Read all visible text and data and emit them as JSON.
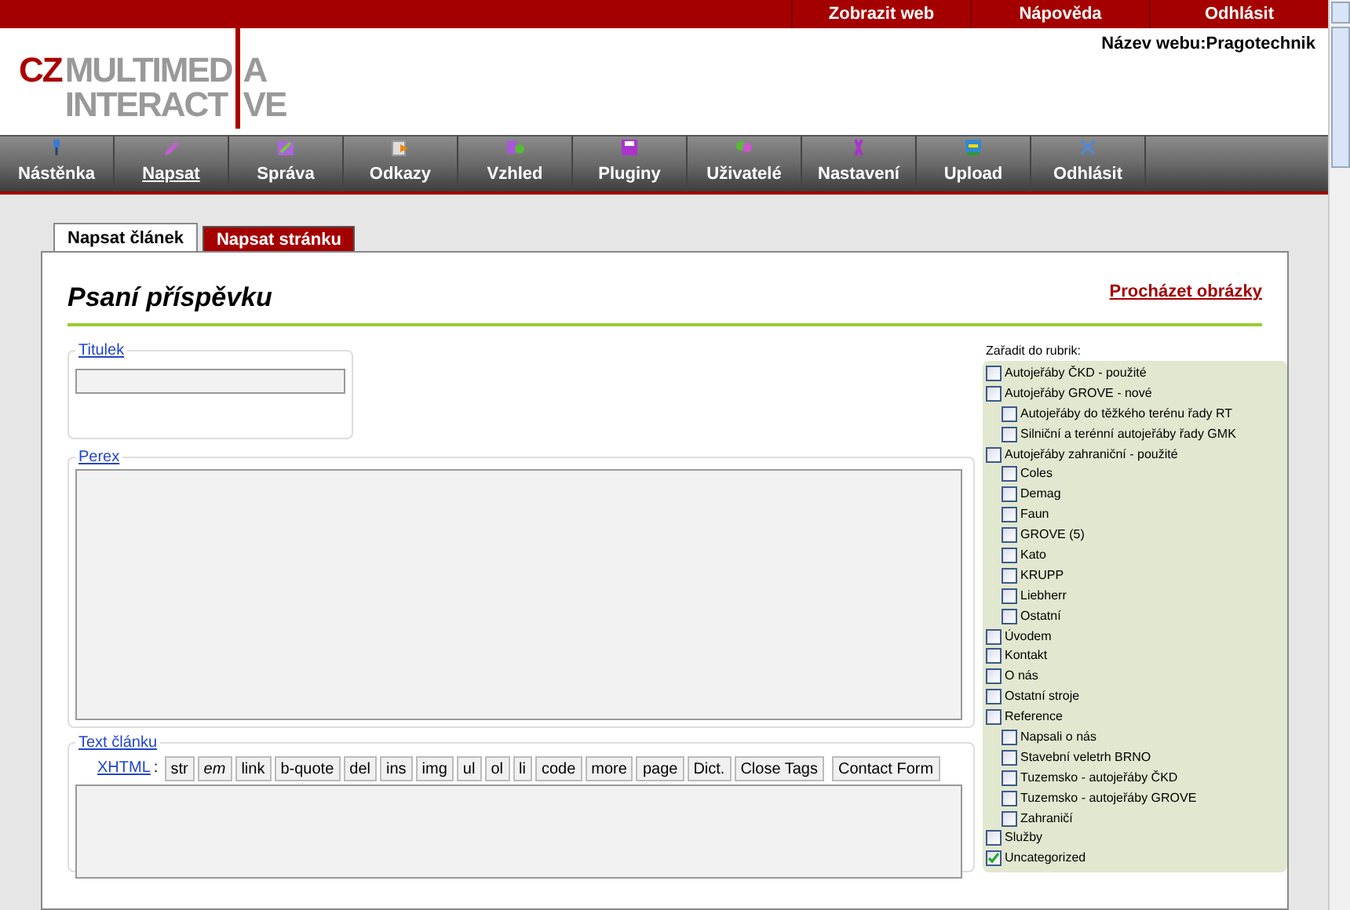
{
  "top_links": [
    "Zobrazit web",
    "Nápověda",
    "Odhlásit"
  ],
  "site_name": "Název webu:Pragotechnik",
  "logo": {
    "cz": "CZ",
    "line1_a": "MULTIMED",
    "line1_b": "A",
    "line2_a": "INTERACT",
    "line2_b": "VE"
  },
  "nav": [
    {
      "label": "Nástěnka",
      "selected": false
    },
    {
      "label": "Napsat",
      "selected": true
    },
    {
      "label": "Správa",
      "selected": false
    },
    {
      "label": "Odkazy",
      "selected": false
    },
    {
      "label": "Vzhled",
      "selected": false
    },
    {
      "label": "Pluginy",
      "selected": false
    },
    {
      "label": "Uživatelé",
      "selected": false
    },
    {
      "label": "Nastavení",
      "selected": false
    },
    {
      "label": "Upload",
      "selected": false
    },
    {
      "label": "Odhlásit",
      "selected": false
    }
  ],
  "tabs": [
    {
      "label": "Napsat článek",
      "selected": true
    },
    {
      "label": "Napsat stránku",
      "selected": false
    }
  ],
  "heading": "Psaní příspěvku",
  "browse_images": "Procházet obrázky",
  "title_field": {
    "legend": "Titulek"
  },
  "perex_field": {
    "legend": "Perex"
  },
  "text_field": {
    "legend": "Text článku",
    "xhtml_label": "XHTML",
    "xhtml_colon": ":",
    "buttons": [
      "str",
      "em",
      "link",
      "b-quote",
      "del",
      "ins",
      "img",
      "ul",
      "ol",
      "li",
      "code",
      "more",
      "page",
      "Dict.",
      "Close Tags",
      "Contact Form"
    ]
  },
  "categories": {
    "label": "Zařadit do rubrik:",
    "items": [
      {
        "label": "Autojeřáby ČKD - použité",
        "checked": false
      },
      {
        "label": "Autojeřáby GROVE - nové",
        "checked": false,
        "children": [
          {
            "label": "Autojeřáby do těžkého terénu řady RT",
            "checked": false
          },
          {
            "label": "Silniční a terénní autojeřáby řady GMK",
            "checked": false
          }
        ]
      },
      {
        "label": "Autojeřáby zahraniční - použité",
        "checked": false,
        "children": [
          {
            "label": "Coles",
            "checked": false
          },
          {
            "label": "Demag",
            "checked": false
          },
          {
            "label": "Faun",
            "checked": false
          },
          {
            "label": "GROVE (5)",
            "checked": false
          },
          {
            "label": "Kato",
            "checked": false
          },
          {
            "label": "KRUPP",
            "checked": false
          },
          {
            "label": "Liebherr",
            "checked": false
          },
          {
            "label": "Ostatní",
            "checked": false
          }
        ]
      },
      {
        "label": "Úvodem",
        "checked": false
      },
      {
        "label": "Kontakt",
        "checked": false
      },
      {
        "label": "O nás",
        "checked": false
      },
      {
        "label": "Ostatní stroje",
        "checked": false
      },
      {
        "label": "Reference",
        "checked": false,
        "children": [
          {
            "label": "Napsali o nás",
            "checked": false
          },
          {
            "label": "Stavební veletrh BRNO",
            "checked": false
          },
          {
            "label": "Tuzemsko - autojeřáby ČKD",
            "checked": false
          },
          {
            "label": "Tuzemsko - autojeřáby GROVE",
            "checked": false
          },
          {
            "label": "Zahraničí",
            "checked": false
          }
        ]
      },
      {
        "label": "Služby",
        "checked": false
      },
      {
        "label": "Uncategorized",
        "checked": true
      }
    ]
  }
}
